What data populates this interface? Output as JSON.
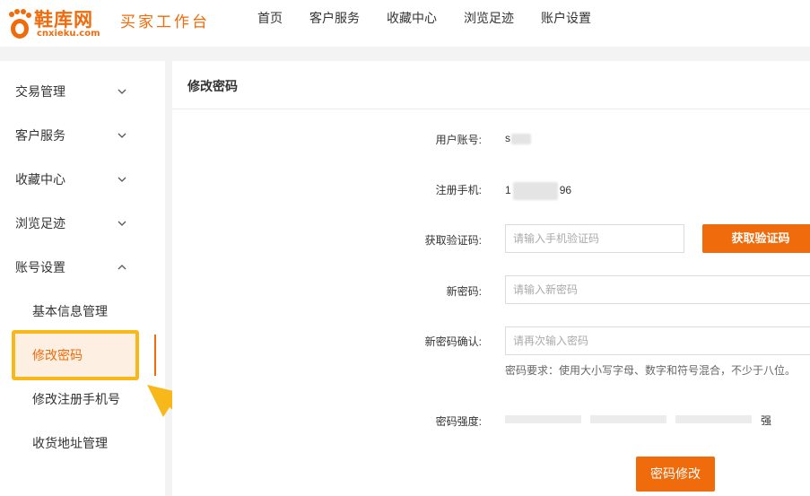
{
  "header": {
    "logo_text": "鞋库网",
    "logo_sub": "cnxieku.com",
    "site_title": "买家工作台",
    "nav": [
      "首页",
      "客户服务",
      "收藏中心",
      "浏览足迹",
      "账户设置"
    ]
  },
  "sidebar": {
    "groups": [
      {
        "label": "交易管理",
        "icon": "chevron-down-icon"
      },
      {
        "label": "客户服务",
        "icon": "chevron-down-icon"
      },
      {
        "label": "收藏中心",
        "icon": "chevron-down-icon"
      },
      {
        "label": "浏览足迹",
        "icon": "chevron-down-icon"
      },
      {
        "label": "账号设置",
        "icon": "chevron-up-icon"
      }
    ],
    "sub_items": [
      "基本信息管理",
      "修改密码",
      "修改注册手机号",
      "收货地址管理"
    ],
    "active_sub_index": 1
  },
  "main": {
    "title": "修改密码",
    "account_label": "用户账号:",
    "account_value": "s",
    "phone_label": "注册手机:",
    "phone_prefix": "1",
    "phone_suffix": "96",
    "code_label": "获取验证码:",
    "code_placeholder": "请输入手机验证码",
    "code_button": "获取验证码",
    "new_pwd_label": "新密码:",
    "new_pwd_placeholder": "请输入新密码",
    "confirm_label": "新密码确认:",
    "confirm_placeholder": "请再次输入密码",
    "hint": "密码要求：使用大小写字母、数字和符号混合，不少于八位。",
    "strength_label": "密码强度:",
    "strength_text": "强",
    "submit_button": "密码修改"
  },
  "colors": {
    "accent": "#ef6b0b",
    "highlight_border": "#f9b81a",
    "highlight_bg": "#fdf0e2"
  }
}
